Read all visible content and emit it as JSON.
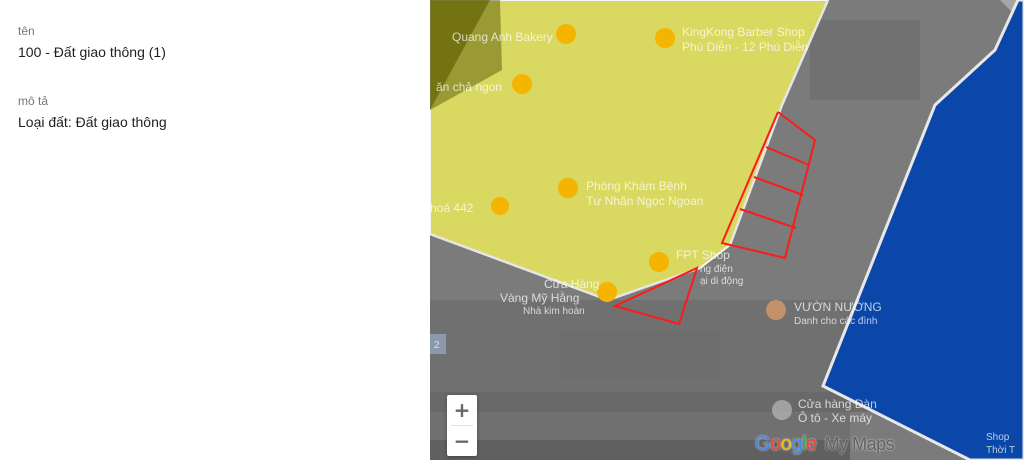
{
  "info_panel": {
    "name_label": "tên",
    "name_value": "100 - Đất giao thông (1)",
    "description_label": "mô tả",
    "description_value": "Loại đất: Đất giao thông"
  },
  "map": {
    "zoom_in_label": "+",
    "zoom_out_label": "−",
    "places": [
      {
        "id": "bakery",
        "label": "Quang Anh Bakery"
      },
      {
        "id": "barber1",
        "label": "KingKong Barber Shop"
      },
      {
        "id": "barber2",
        "label": "Phú Diễn - 12 Phú Diễn"
      },
      {
        "id": "restaurant",
        "label": "ăn chả ngon"
      },
      {
        "id": "clinic1",
        "label": "Phòng Khám Bệnh"
      },
      {
        "id": "clinic2",
        "label": "Tư Nhân Ngọc Ngoan"
      },
      {
        "id": "khoa",
        "label": "hoá 442"
      },
      {
        "id": "fpt",
        "label": "FPT Shop"
      },
      {
        "id": "phone1",
        "label": "ng điện"
      },
      {
        "id": "phone2",
        "label": "ại di động"
      },
      {
        "id": "jewel1",
        "label": "Cửa Hàng"
      },
      {
        "id": "jewel2",
        "label": "Vàng Mỹ Hằng"
      },
      {
        "id": "jewel3",
        "label": "Nhà kim hoàn"
      },
      {
        "id": "vuon1",
        "label": "VƯỜN NƯỚNG"
      },
      {
        "id": "vuon2",
        "label": "Danh cho các đình"
      },
      {
        "id": "car1",
        "label": "Cửa hàng Đàn"
      },
      {
        "id": "car2",
        "label": "Ô tô - Xe máy"
      },
      {
        "id": "shop1",
        "label": "Shop"
      },
      {
        "id": "shop2",
        "label": "Thời T"
      },
      {
        "id": "road",
        "label": "2"
      }
    ],
    "brand_google": "Google",
    "brand_mymaps": "My Maps",
    "colors": {
      "yellow_area": "#ffff00",
      "blue_area": "#0a47a8",
      "parcel_outline": "#ff1a1a",
      "boundary": "#e8e8e8"
    }
  }
}
